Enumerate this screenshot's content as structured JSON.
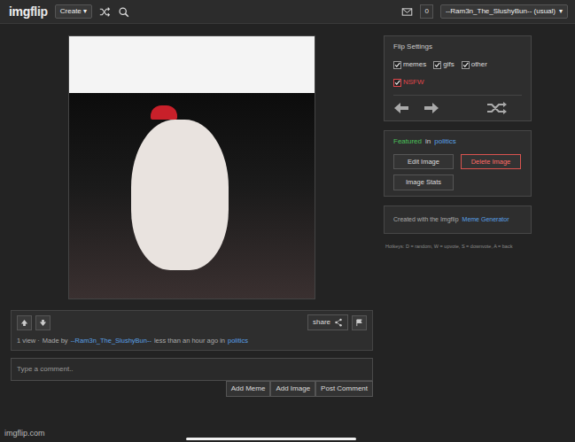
{
  "navbar": {
    "logo_a": "img",
    "logo_b": "flip",
    "create": "Create ▾",
    "notifications": "0",
    "user": "--Ram3n_The_SlushyBun-- (usual)",
    "user_caret": "▾"
  },
  "vote_bar": {
    "share": "share",
    "meta": {
      "views": "1 view ·",
      "made_by": "Made by",
      "user": "--Ram3n_The_SlushyBun--",
      "time": "less than an hour ago in",
      "category": "politics"
    }
  },
  "comment": {
    "placeholder": "Type a comment..",
    "buttons": [
      "Add Meme",
      "Add Image",
      "Post Comment"
    ]
  },
  "flip_settings": {
    "title": "Flip Settings",
    "options": [
      {
        "label": "memes",
        "checked": true,
        "color": "#dddddd"
      },
      {
        "label": "gifs",
        "checked": true,
        "color": "#dddddd"
      },
      {
        "label": "other",
        "checked": true,
        "color": "#dddddd"
      },
      {
        "label": "NSFW",
        "checked": true,
        "color": "#e0474c"
      }
    ]
  },
  "featured": {
    "featured": "Featured",
    "in": "in",
    "category": "politics"
  },
  "actions": [
    {
      "label": "Edit Image",
      "danger": false
    },
    {
      "label": "Delete Image",
      "danger": true
    },
    {
      "label": "Image Stats",
      "danger": false
    }
  ],
  "generator": {
    "prefix": "Created with the Imgflip",
    "link": "Meme Generator"
  },
  "hotkeys": "Hotkeys: D = random, W = upvote, S = downvote, A = back",
  "watermark": "imgflip.com"
}
